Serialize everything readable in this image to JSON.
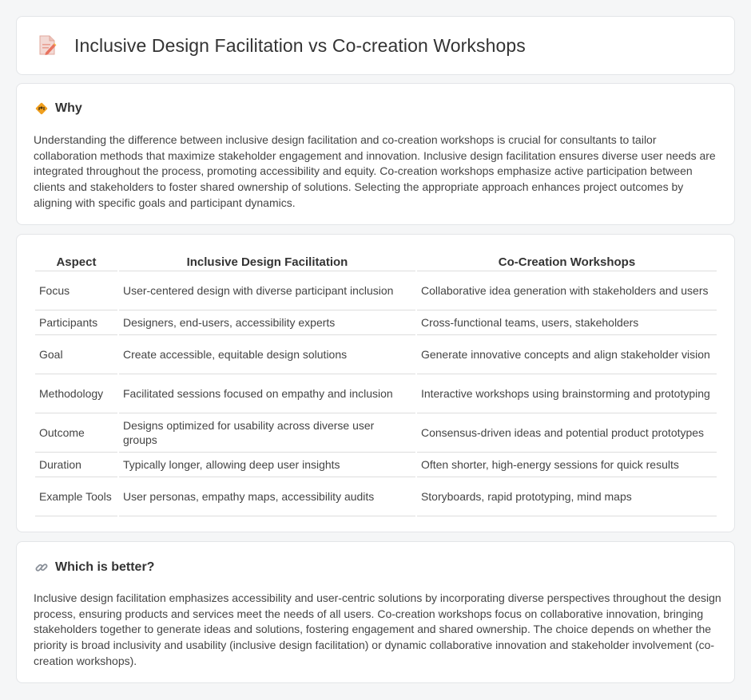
{
  "page": {
    "title": "Inclusive Design Facilitation vs Co-creation Workshops",
    "title_icon": "document-pencil-icon"
  },
  "why": {
    "heading": "Why",
    "icon": "road-sign-icon",
    "text": "Understanding the difference between inclusive design facilitation and co-creation workshops is crucial for consultants to tailor collaboration methods that maximize stakeholder engagement and innovation. Inclusive design facilitation ensures diverse user needs are integrated throughout the process, promoting accessibility and equity. Co-creation workshops emphasize active participation between clients and stakeholders to foster shared ownership of solutions. Selecting the appropriate approach enhances project outcomes by aligning with specific goals and participant dynamics."
  },
  "table": {
    "headers": [
      "Aspect",
      "Inclusive Design Facilitation",
      "Co-Creation Workshops"
    ],
    "rows": [
      [
        "Focus",
        "User-centered design with diverse participant inclusion",
        "Collaborative idea generation with stakeholders and users"
      ],
      [
        "Participants",
        "Designers, end-users, accessibility experts",
        "Cross-functional teams, users, stakeholders"
      ],
      [
        "Goal",
        "Create accessible, equitable design solutions",
        "Generate innovative concepts and align stakeholder vision"
      ],
      [
        "Methodology",
        "Facilitated sessions focused on empathy and inclusion",
        "Interactive workshops using brainstorming and prototyping"
      ],
      [
        "Outcome",
        "Designs optimized for usability across diverse user groups",
        "Consensus-driven ideas and potential product prototypes"
      ],
      [
        "Duration",
        "Typically longer, allowing deep user insights",
        "Often shorter, high-energy sessions for quick results"
      ],
      [
        "Example Tools",
        "User personas, empathy maps, accessibility audits",
        "Storyboards, rapid prototyping, mind maps"
      ]
    ]
  },
  "better": {
    "heading": "Which is better?",
    "icon": "link-icon",
    "text": "Inclusive design facilitation emphasizes accessibility and user-centric solutions by incorporating diverse perspectives throughout the design process, ensuring products and services meet the needs of all users. Co-creation workshops focus on collaborative innovation, bringing stakeholders together to generate ideas and solutions, fostering engagement and shared ownership. The choice depends on whether the priority is broad inclusivity and usability (inclusive design facilitation) or dynamic collaborative innovation and stakeholder involvement (co-creation workshops)."
  }
}
